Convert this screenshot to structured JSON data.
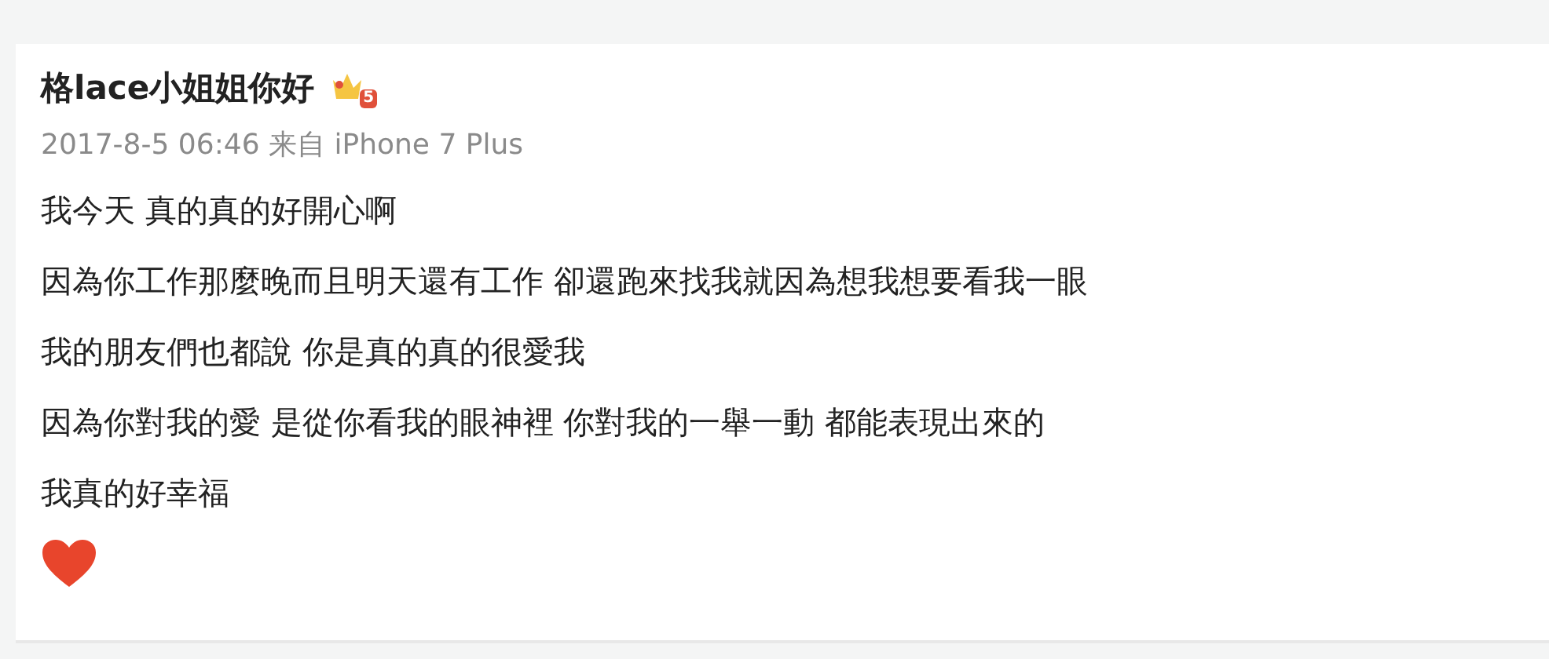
{
  "post": {
    "author": "格lace小姐姐你好",
    "level_badge": "5",
    "timestamp": "2017-8-5 06:46 来自 iPhone 7 Plus",
    "lines": [
      "我今天 真的真的好開心啊",
      "因為你工作那麼晚而且明天還有工作 卻還跑來找我就因為想我想要看我一眼",
      "我的朋友們也都說 你是真的真的很愛我",
      "因為你對我的愛 是從你看我的眼神裡 你對我的一舉一動 都能表現出來的",
      "我真的好幸福"
    ]
  }
}
